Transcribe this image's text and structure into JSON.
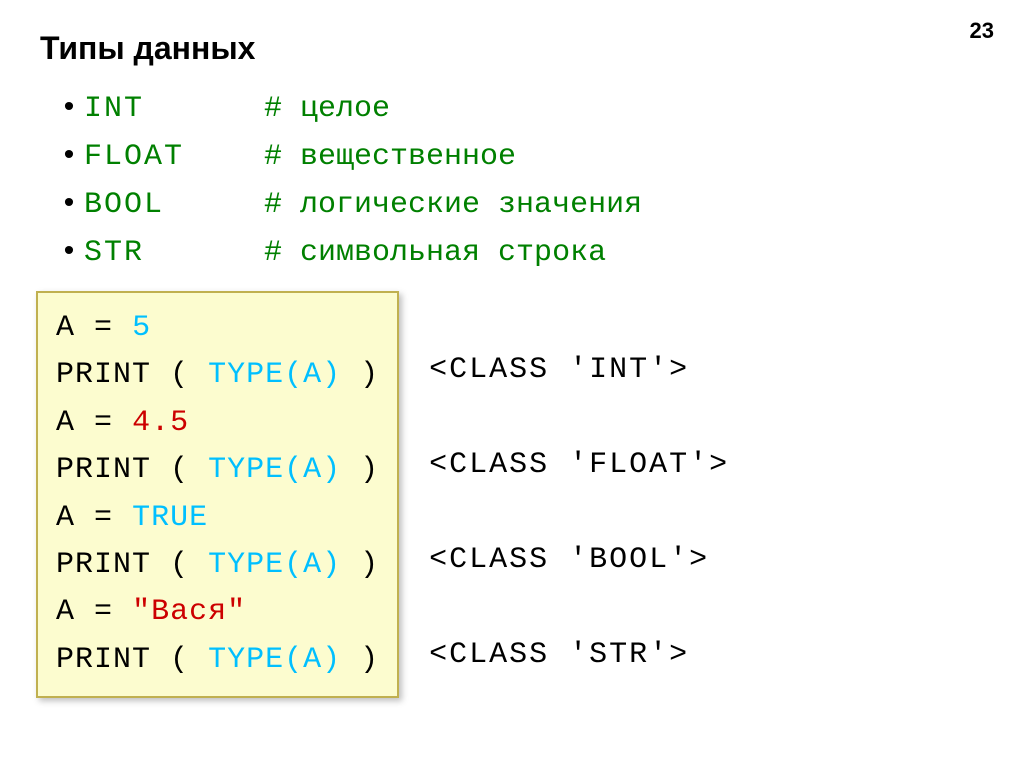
{
  "page_number": "23",
  "title": "Типы данных",
  "types": [
    {
      "name": "INT",
      "comment": "# целое"
    },
    {
      "name": "FLOAT",
      "comment": "# вещественное"
    },
    {
      "name": "BOOL",
      "comment": "# логические значения"
    },
    {
      "name": "STR",
      "comment": "# символьная строка"
    }
  ],
  "code": {
    "l1_a": "A",
    "l1_eq": "=",
    "l1_v": "5",
    "l2_p": "PRINT",
    "l2_o": "(",
    "l2_t": "TYPE(A)",
    "l2_c": ")",
    "l3_a": "A",
    "l3_eq": "=",
    "l3_v": "4.5",
    "l4_p": "PRINT",
    "l4_o": "(",
    "l4_t": "TYPE(A)",
    "l4_c": ")",
    "l5_a": "A",
    "l5_eq": "=",
    "l5_v": "TRUE",
    "l6_p": "PRINT",
    "l6_o": "(",
    "l6_t": "TYPE(A)",
    "l6_c": ")",
    "l7_a": "A",
    "l7_eq": "=",
    "l7_v": "\"Вася\"",
    "l8_p": "PRINT",
    "l8_o": "(",
    "l8_t": "TYPE(A)",
    "l8_c": ")"
  },
  "outputs": [
    "<CLASS 'INT'>",
    "<CLASS 'FLOAT'>",
    "<CLASS 'BOOL'>",
    "<CLASS 'STR'>"
  ]
}
